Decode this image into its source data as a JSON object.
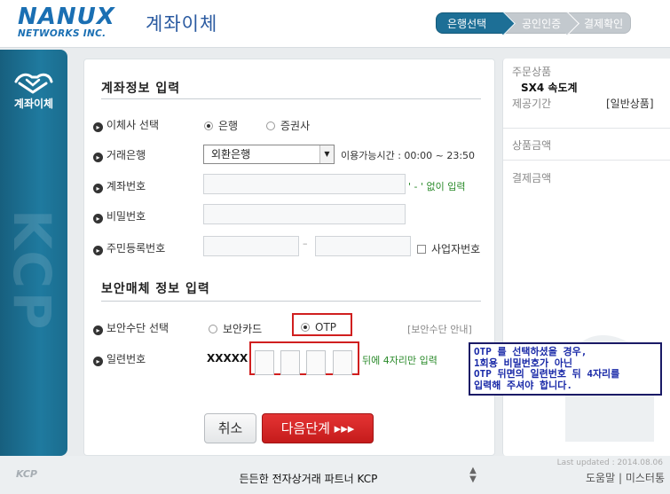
{
  "header": {
    "logo_word": "NANUX",
    "logo_sub": "NETWORKS INC.",
    "title": "계좌이체",
    "steps": [
      "은행선택",
      "공인인증",
      "결제확인"
    ]
  },
  "sidebar": {
    "label": "계좌이체",
    "watermark": "KCP",
    "icon": "transfer-hands-icon"
  },
  "main": {
    "section1_title": "계좌정보 입력",
    "transfer_type": {
      "label": "이체사 선택",
      "options": [
        "은행",
        "증권사"
      ],
      "selected": "은행"
    },
    "bank": {
      "label": "거래은행",
      "value": "외환은행",
      "hours": "이용가능시간 : 00:00 ~ 23:50"
    },
    "account": {
      "label": "계좌번호",
      "hint": "' - ' 없이 입력"
    },
    "password": {
      "label": "비밀번호"
    },
    "resident": {
      "label": "주민등록번호",
      "dash": "–",
      "business_label": "사업자번호"
    },
    "section2_title": "보안매체 정보 입력",
    "security_method": {
      "label": "보안수단 선택",
      "options": [
        "보안카드",
        "OTP"
      ],
      "selected": "OTP",
      "guide": "[보안수단 안내]"
    },
    "serial": {
      "label": "일련번호",
      "prefix": "XXXXX",
      "hint": "뒤에 4자리만 입력"
    },
    "cancel_label": "취소",
    "next_label": "다음단계 ▸▸▸"
  },
  "tooltip": {
    "lines": [
      "OTP 를 선택하셨을 경우,",
      "1회용 비밀번호가 아닌",
      "OTP 뒤면의 일련번호 뒤 4자리를",
      "입력해 주셔야 합니다."
    ]
  },
  "right_panel": {
    "product_label": "주문상품",
    "product_name": "SX4 속도계",
    "period_label": "제공기간",
    "period_value": "[일반상품]",
    "amount_label": "상품금액",
    "pay_label": "결제금액"
  },
  "footer": {
    "logo": "KCP",
    "slogan": "든든한 전자상거래 파트너 KCP",
    "updated": "Last updated : 2014.08.06",
    "help": "도움말",
    "mystery": "미스터통",
    "separator": "|"
  },
  "colors": {
    "brand_blue": "#1a6fb3",
    "step_active": "#1d6f96",
    "sidebar": "#1f7a9f",
    "next_button": "#d42424",
    "highlight_red": "#d01f1f",
    "tooltip_text": "#1a2aa8"
  }
}
